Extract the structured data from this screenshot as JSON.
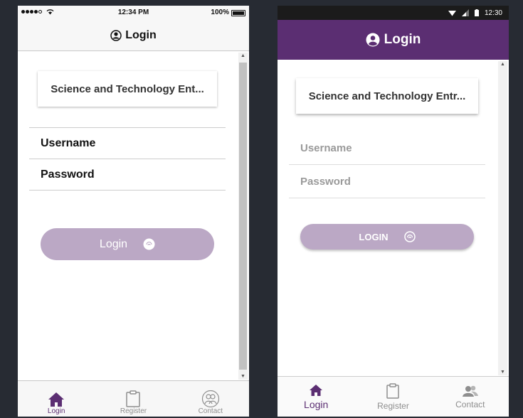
{
  "ios": {
    "status": {
      "time": "12:34 PM",
      "battery": "100%"
    },
    "header": {
      "title": "Login",
      "icon": "user-circle-icon"
    },
    "organization": "Science and Technology Ent...",
    "username_placeholder": "Username",
    "password_placeholder": "Password",
    "login_button": "Login",
    "tabs": [
      {
        "label": "Login",
        "icon": "home-icon"
      },
      {
        "label": "Register",
        "icon": "clipboard-icon"
      },
      {
        "label": "Contact",
        "icon": "contacts-icon"
      }
    ]
  },
  "android": {
    "status": {
      "time": "12:30"
    },
    "header": {
      "title": "Login",
      "icon": "user-circle-icon"
    },
    "organization": "Science and Technology Entr...",
    "username_placeholder": "Username",
    "password_placeholder": "Password",
    "login_button": "LOGIN",
    "tabs": [
      {
        "label": "Login",
        "icon": "home-icon"
      },
      {
        "label": "Register",
        "icon": "clipboard-icon"
      },
      {
        "label": "Contact",
        "icon": "contacts-icon"
      }
    ]
  },
  "colors": {
    "primary": "#5b2e72",
    "button": "#bba8c5",
    "background": "#272b33",
    "inactive": "#8e8e8e"
  }
}
